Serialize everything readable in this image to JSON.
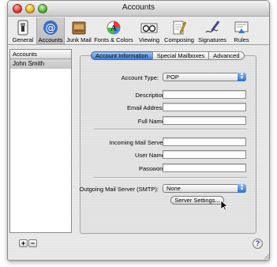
{
  "window": {
    "title": "Accounts"
  },
  "toolbar": {
    "items": [
      {
        "label": "General",
        "icon": "general-switch-icon"
      },
      {
        "label": "Accounts",
        "icon": "at-sign-icon",
        "selected": true
      },
      {
        "label": "Junk Mail",
        "icon": "junk-mail-icon"
      },
      {
        "label": "Fonts & Colors",
        "icon": "fonts-colors-icon"
      },
      {
        "label": "Viewing",
        "icon": "glasses-icon"
      },
      {
        "label": "Composing",
        "icon": "pencil-pad-icon"
      },
      {
        "label": "Signatures",
        "icon": "signature-pen-icon"
      },
      {
        "label": "Rules",
        "icon": "rules-icon"
      }
    ]
  },
  "accounts_list": {
    "header": "Accounts",
    "rows": [
      "John Smith"
    ],
    "add_label": "+",
    "remove_label": "−"
  },
  "tabs": [
    {
      "label": "Account Information",
      "active": true
    },
    {
      "label": "Special Mailboxes",
      "active": false
    },
    {
      "label": "Advanced",
      "active": false
    }
  ],
  "form": {
    "account_type_label": "Account Type:",
    "account_type_value": "POP",
    "description_label": "Description:",
    "description_value": "",
    "email_label": "Email Address:",
    "email_value": "",
    "fullname_label": "Full Name:",
    "fullname_value": "",
    "incoming_label": "Incoming Mail Server:",
    "incoming_value": "",
    "username_label": "User Name:",
    "username_value": "",
    "password_label": "Password:",
    "password_value": "",
    "smtp_label": "Outgoing Mail Server (SMTP):",
    "smtp_value": "None",
    "server_settings_label": "Server Settings..."
  },
  "help_label": "?",
  "colors": {
    "tab_active": "#3c7fd8",
    "popup_arrow": "#2d6fcf"
  }
}
